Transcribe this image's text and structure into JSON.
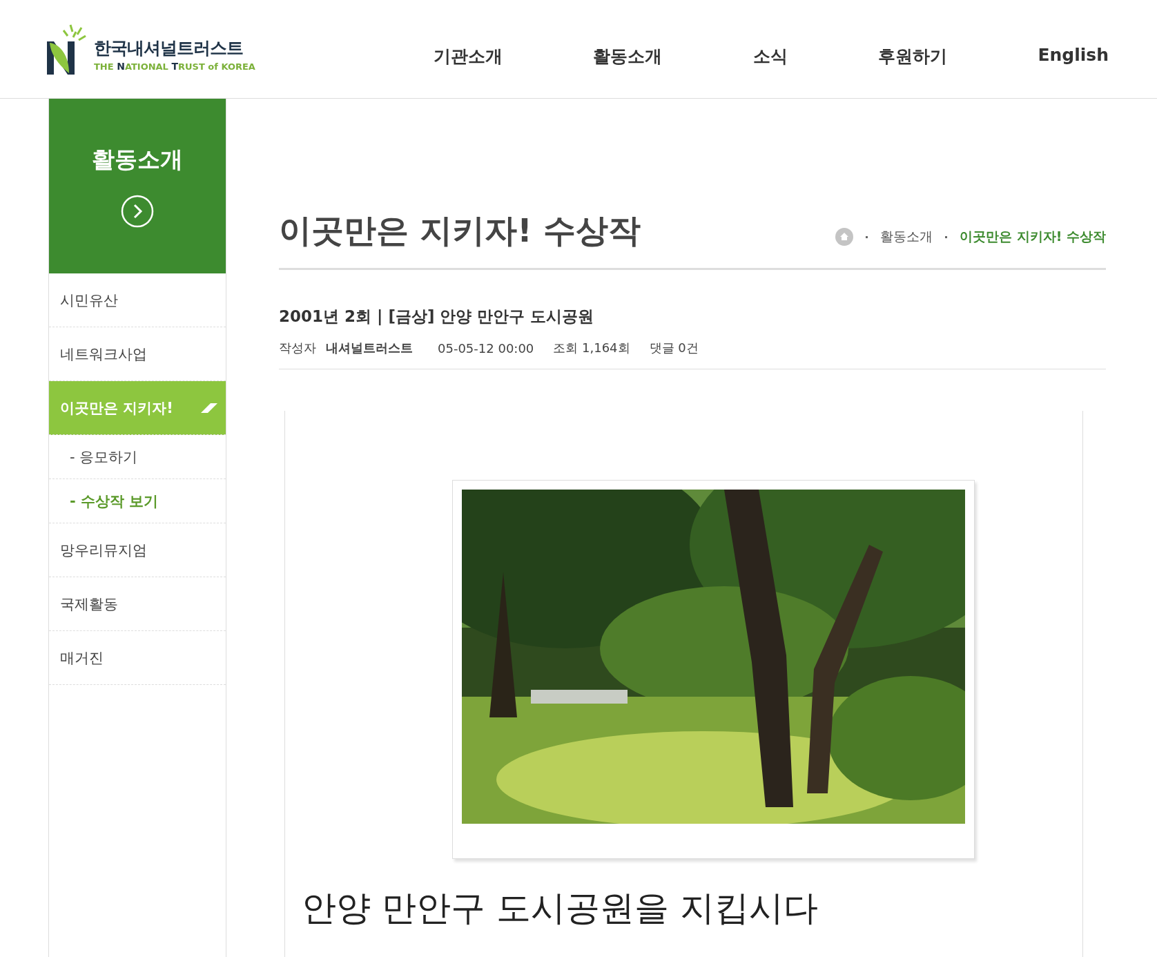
{
  "logo": {
    "name": "한국내셔널트러스트",
    "tagline": "THE **N**ATIONAL **T**RUST of KOREA"
  },
  "nav": [
    "기관소개",
    "활동소개",
    "소식",
    "후원하기",
    "English"
  ],
  "sidebar": {
    "title": "활동소개",
    "items": [
      {
        "label": "시민유산",
        "selected": false
      },
      {
        "label": "네트워크사업",
        "selected": false
      },
      {
        "label": "이곳만은 지키자!",
        "selected": true,
        "children": [
          {
            "label": "- 응모하기",
            "selected": false
          },
          {
            "label": "- 수상작 보기",
            "selected": true
          }
        ]
      },
      {
        "label": "망우리뮤지엄",
        "selected": false
      },
      {
        "label": "국제활동",
        "selected": false
      },
      {
        "label": "매거진",
        "selected": false
      }
    ]
  },
  "page_title": "이곳만은 지키자! 수상작",
  "breadcrumb": [
    "활동소개",
    "이곳만은 지키자! 수상작"
  ],
  "post": {
    "title": "2001년 2회 | [금상] 안양 만안구 도시공원",
    "author_label": "작성자",
    "author": "내셔널트러스트",
    "date": "05-05-12 00:00",
    "views": "조회 1,164회",
    "comments": "댓글 0건",
    "caption": "안양 만안구 도시공원을 지킵시다"
  }
}
